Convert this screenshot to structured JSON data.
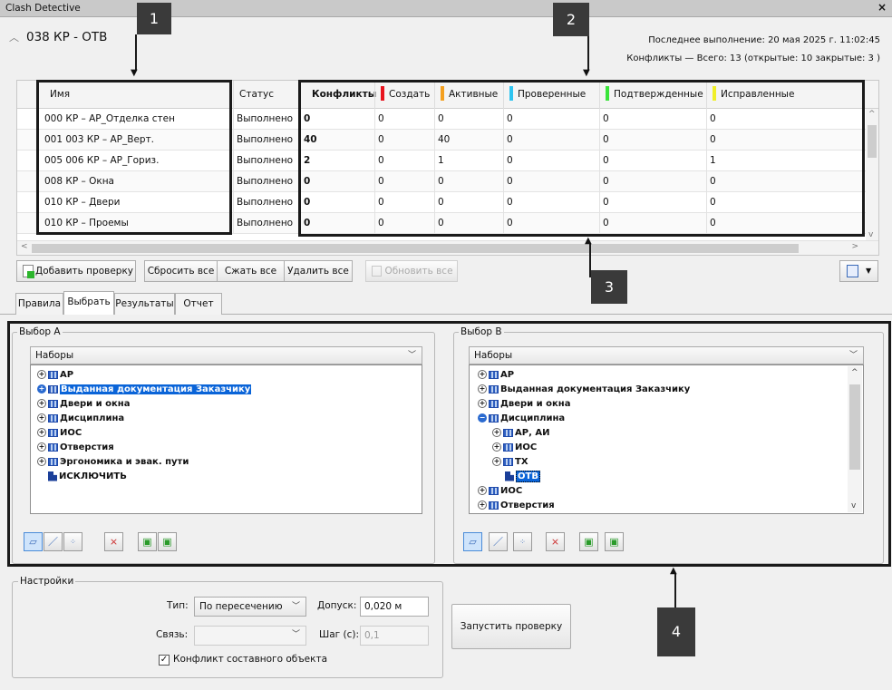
{
  "window": {
    "title": "Clash Detective",
    "close": "×"
  },
  "test": {
    "name": "038 КР - ОТВ"
  },
  "run_info": {
    "last_run": "Последнее выполнение:  20 мая 2025 г. 11:02:45",
    "summary": "Конфликты —  Всего:  13  (открытые:  10  закрытые:  3 )"
  },
  "grid": {
    "headers": {
      "name": "Имя",
      "status": "Статус",
      "clashes": "Конфликты",
      "new": "Создать",
      "active": "Активные",
      "reviewed": "Проверенные",
      "approved": "Подтвержденные",
      "resolved": "Исправленные"
    },
    "status_colors": {
      "new": "#e8141e",
      "active": "#f4a020",
      "reviewed": "#2ec4f0",
      "approved": "#39e43a",
      "resolved": "#f0ef28"
    },
    "rows": [
      {
        "name": "000 КР – АР_Отделка стен",
        "status": "Выполнено",
        "clashes": "0",
        "new": "0",
        "active": "0",
        "reviewed": "0",
        "approved": "0",
        "resolved": "0"
      },
      {
        "name": "001 003 КР – АР_Верт.",
        "status": "Выполнено",
        "clashes": "40",
        "new": "0",
        "active": "40",
        "reviewed": "0",
        "approved": "0",
        "resolved": "0"
      },
      {
        "name": "005 006 КР – АР_Гориз.",
        "status": "Выполнено",
        "clashes": "2",
        "new": "0",
        "active": "1",
        "reviewed": "0",
        "approved": "0",
        "resolved": "1"
      },
      {
        "name": "008 КР – Окна",
        "status": "Выполнено",
        "clashes": "0",
        "new": "0",
        "active": "0",
        "reviewed": "0",
        "approved": "0",
        "resolved": "0"
      },
      {
        "name": "010 КР – Двери",
        "status": "Выполнено",
        "clashes": "0",
        "new": "0",
        "active": "0",
        "reviewed": "0",
        "approved": "0",
        "resolved": "0"
      },
      {
        "name": "010 КР – Проемы",
        "status": "Выполнено",
        "clashes": "0",
        "new": "0",
        "active": "0",
        "reviewed": "0",
        "approved": "0",
        "resolved": "0"
      }
    ]
  },
  "toolbar": {
    "add": "Добавить проверку",
    "reset": "Сбросить все",
    "compact": "Сжать все",
    "delete": "Удалить все",
    "refresh": "Обновить все"
  },
  "tabs": [
    "Правила",
    "Выбрать",
    "Результаты",
    "Отчет"
  ],
  "selection_a": {
    "label": "Выбор A",
    "dropdown": "Наборы",
    "items": [
      {
        "text": "АР"
      },
      {
        "text": "Выданная документация Заказчику"
      },
      {
        "text": "Двери и окна"
      },
      {
        "text": "Дисциплина"
      },
      {
        "text": "ИОС"
      },
      {
        "text": "Отверстия"
      },
      {
        "text": "Эргономика и эвак. пути"
      },
      {
        "text": "ИСКЛЮЧИТЬ"
      }
    ]
  },
  "selection_b": {
    "label": "Выбор B",
    "dropdown": "Наборы",
    "items": [
      {
        "text": "АР"
      },
      {
        "text": "Выданная документация Заказчику"
      },
      {
        "text": "Двери и окна"
      },
      {
        "text": "Дисциплина"
      },
      {
        "text": "АР, АИ"
      },
      {
        "text": "ИОС"
      },
      {
        "text": "ТХ"
      },
      {
        "text": "ОТВ"
      },
      {
        "text": "ИОС"
      },
      {
        "text": "Отверстия"
      }
    ]
  },
  "settings": {
    "label": "Настройки",
    "type_label": "Тип:",
    "type_value": "По пересечению",
    "tolerance_label": "Допуск:",
    "tolerance_value": "0,020 м",
    "link_label": "Связь:",
    "link_value": "",
    "step_label": "Шаг (с):",
    "step_value": "0,1",
    "composite_label": "Конфликт составного объекта",
    "composite_checked": true,
    "run": "Запустить проверку"
  },
  "callouts": [
    "1",
    "2",
    "3",
    "4"
  ]
}
